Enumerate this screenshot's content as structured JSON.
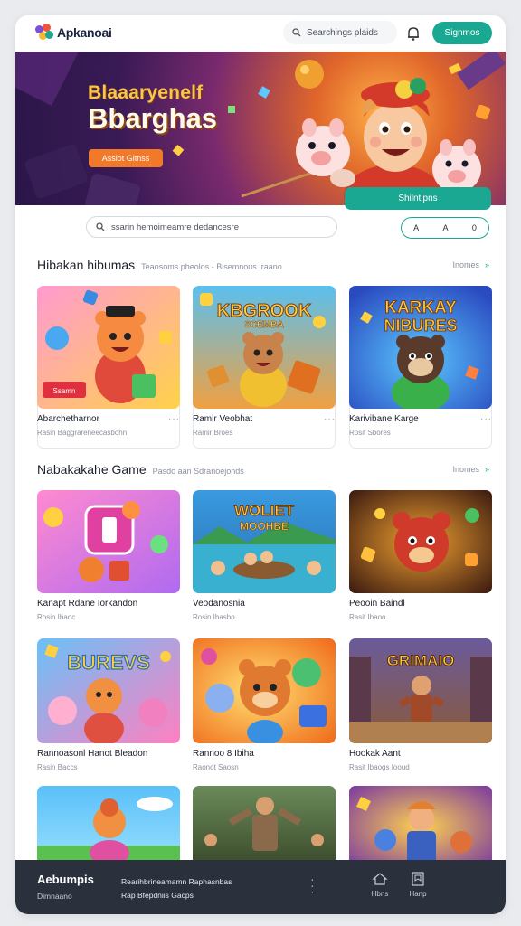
{
  "header": {
    "logo_text": "Apkanoai",
    "search_placeholder": "Searchings plaids",
    "cta_label": "Signmos"
  },
  "hero": {
    "title_line1": "Blaaaryenelf",
    "title_line2": "Bbarghas",
    "button_label": "Assiot Gitnss",
    "pill_label": "Shilntipns"
  },
  "search": {
    "placeholder": "ssarin hemoimeamre dedancesre",
    "segments": [
      "A",
      "A",
      "0"
    ]
  },
  "section1": {
    "title": "Hibakan hibumas",
    "subtitle": "Teaosoms pheolos - Bisemnous Iraano",
    "more_label": "Inomes",
    "cards": [
      {
        "title": "Abarchetharnor",
        "sub": "Rasin Baggrareneecasbohn",
        "badge": "Ssamn"
      },
      {
        "title": "Ramir Veobhat",
        "sub": "Ramir Broes",
        "art_title": "KBGROOK",
        "art_sub": "SCEMBA"
      },
      {
        "title": "Karivibane Karge",
        "sub": "Rosit Sbores",
        "art_title": "KARKAY",
        "art_sub": "NIBURES"
      }
    ]
  },
  "section2": {
    "title": "Nabakakahe Game",
    "subtitle": "Pasdo aan Sdranoejonds",
    "more_label": "Inomes",
    "cards": [
      {
        "title": "Kanapt Rdane Iorkandon",
        "sub": "Rosin Ibaoc"
      },
      {
        "title": "Veodanosnia",
        "sub": "Rosin Ibasbo",
        "art_title": "WOLIET",
        "art_sub": "MOOHBE"
      },
      {
        "title": "Peooin Baindl",
        "sub": "Rasit Ibaoo"
      },
      {
        "title": "Rannoasonl Hanot Bleadon",
        "sub": "Rasin Baccs",
        "art_title": "BUREVS"
      },
      {
        "title": "Rannoo 8 Ibiha",
        "sub": "Raonot Saosn"
      },
      {
        "title": "Hookak Aant",
        "sub": "Rasit Ibaogs Iooud",
        "art_title": "GRIMAIO"
      },
      {
        "title": "",
        "sub": ""
      },
      {
        "title": "",
        "sub": ""
      },
      {
        "title": "",
        "sub": ""
      }
    ]
  },
  "footer": {
    "brand": "Aebumpis",
    "brand_sub": "Dimnaano",
    "link1": "Rearihbrineamamn Raphasnbas",
    "link2": "Rap Bfepdniis Gacps",
    "icon1_label": "Hbns",
    "icon2_label": "Hanp"
  },
  "colors": {
    "accent": "#1aa893",
    "hero_button": "#f07a2a",
    "footer_bg": "#2a313d"
  }
}
